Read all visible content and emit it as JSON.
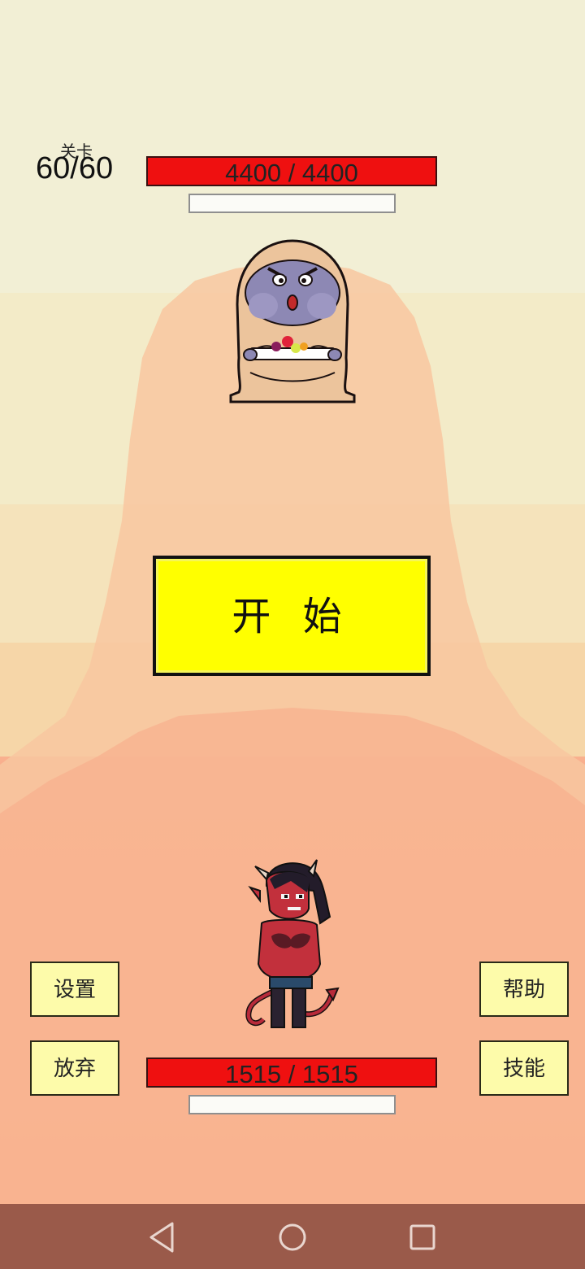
{
  "level": {
    "label": "关卡",
    "value": "60/60"
  },
  "enemy": {
    "hp_text": "4400 / 4400",
    "hp_fraction": 1.0
  },
  "player": {
    "hp_text": "1515 / 1515",
    "hp_fraction": 1.0
  },
  "start_button": {
    "label": "开 始"
  },
  "side_buttons": {
    "settings": "设置",
    "give_up": "放弃",
    "help": "帮助",
    "skills": "技能"
  },
  "colors": {
    "hp_bar": "#ef1010",
    "start_button": "#ffff00",
    "side_button": "#fdfbaa",
    "nav_bar": "#9a5a4a"
  },
  "icons": {
    "nav_back": "back-triangle-icon",
    "nav_home": "home-circle-icon",
    "nav_recent": "recents-square-icon"
  }
}
